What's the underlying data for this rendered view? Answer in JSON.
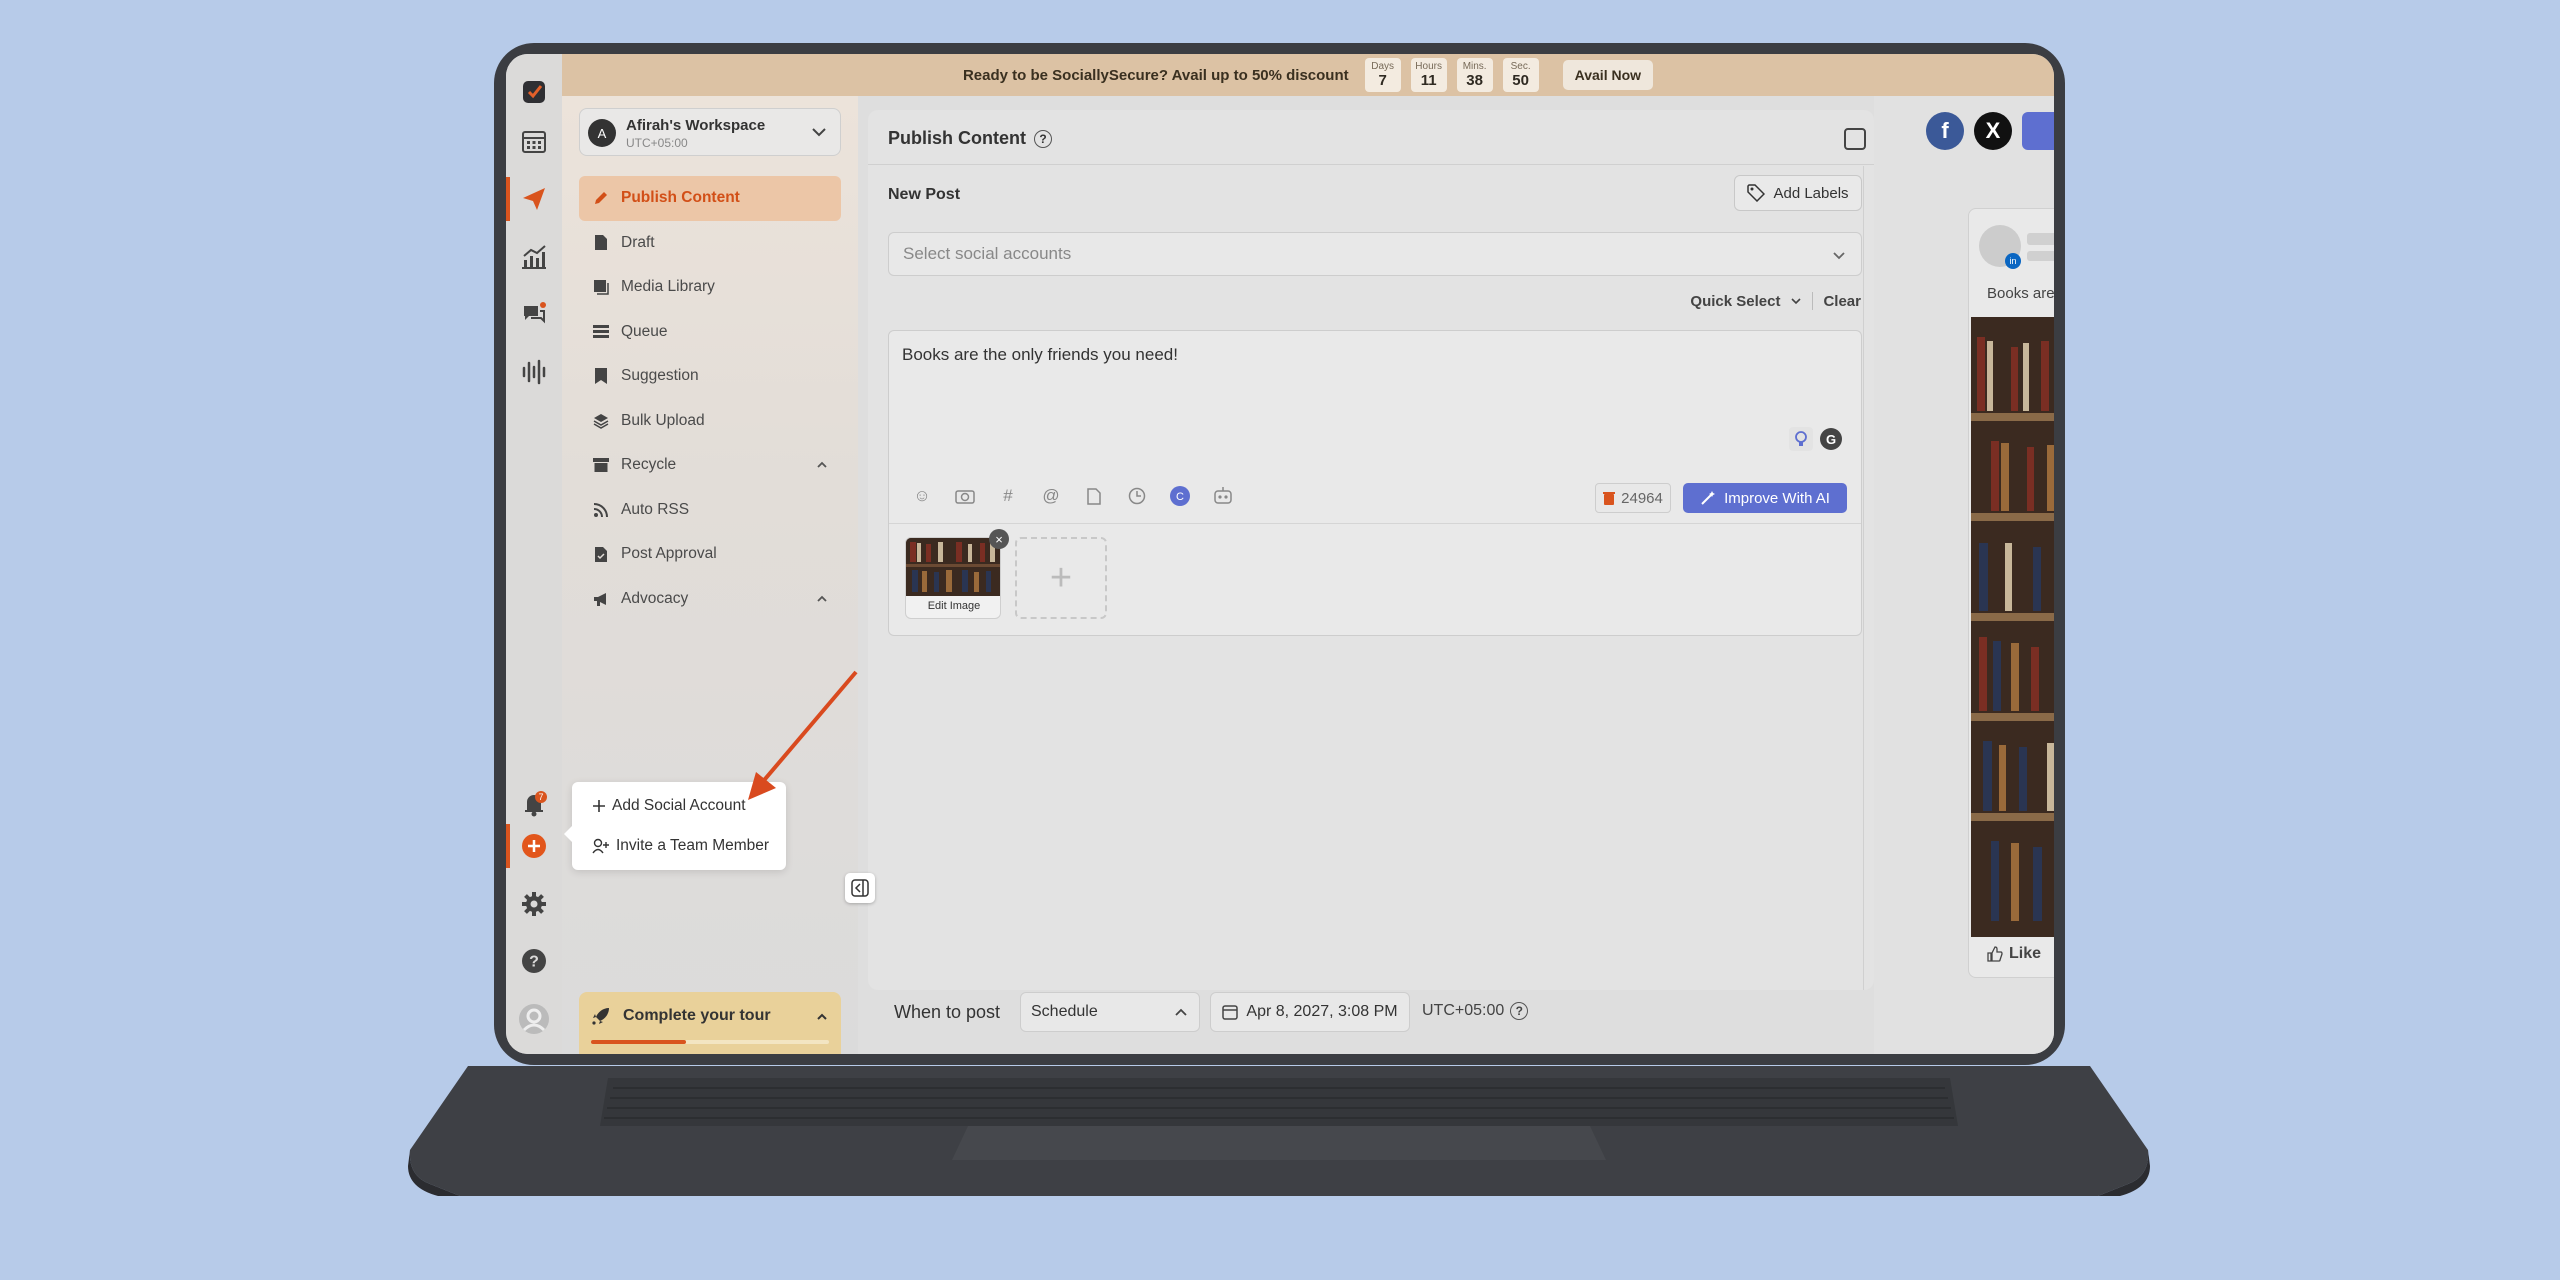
{
  "banner": {
    "promo": "Ready to be SociallySecure? Avail up to 50% discount",
    "countdown": [
      {
        "unit": "Days",
        "value": "7"
      },
      {
        "unit": "Hours",
        "value": "11"
      },
      {
        "unit": "Mins.",
        "value": "38"
      },
      {
        "unit": "Sec.",
        "value": "50"
      }
    ],
    "cta": "Avail Now"
  },
  "rail": {
    "notification_count": "7",
    "icons": [
      "logo-icon",
      "calendar-icon",
      "send-icon",
      "analytics-icon",
      "chat-icon",
      "audio-icon",
      "bell-icon",
      "add-icon",
      "settings-icon",
      "help-icon",
      "profile-icon"
    ]
  },
  "workspace": {
    "avatar": "A",
    "name": "Afirah's Workspace",
    "timezone": "UTC+05:00"
  },
  "menu": [
    {
      "label": "Publish Content",
      "icon": "pen-icon"
    },
    {
      "label": "Draft",
      "icon": "file-icon"
    },
    {
      "label": "Media Library",
      "icon": "media-icon"
    },
    {
      "label": "Queue",
      "icon": "queue-icon"
    },
    {
      "label": "Suggestion",
      "icon": "bookmark-icon"
    },
    {
      "label": "Bulk Upload",
      "icon": "layers-icon"
    },
    {
      "label": "Recycle",
      "icon": "archive-icon"
    },
    {
      "label": "Auto RSS",
      "icon": "rss-icon"
    },
    {
      "label": "Post Approval",
      "icon": "approval-icon"
    },
    {
      "label": "Advocacy",
      "icon": "megaphone-icon"
    }
  ],
  "tour": {
    "label": "Complete your tour",
    "progress": 0.4
  },
  "editor": {
    "title": "Publish Content",
    "new_post": "New Post",
    "add_labels": "Add Labels",
    "accounts_placeholder": "Select social accounts",
    "quick_select": "Quick Select",
    "clear": "Clear",
    "post_text": "Books are the only friends you need!",
    "char_count": "24964",
    "improve_ai": "Improve With AI",
    "edit_image": "Edit Image"
  },
  "footer": {
    "when_label": "When to post",
    "schedule": "Schedule",
    "date": "Apr 8, 2027, 3:08 PM",
    "timezone": "UTC+05:00"
  },
  "preview": {
    "caption": "Books are",
    "like": "Like"
  },
  "popup": {
    "add_account": "Add Social Account",
    "invite": "Invite a Team Member"
  },
  "colors": {
    "accent": "#d9541e",
    "ai": "#5e6fd0",
    "background": "#b7cbe9"
  }
}
